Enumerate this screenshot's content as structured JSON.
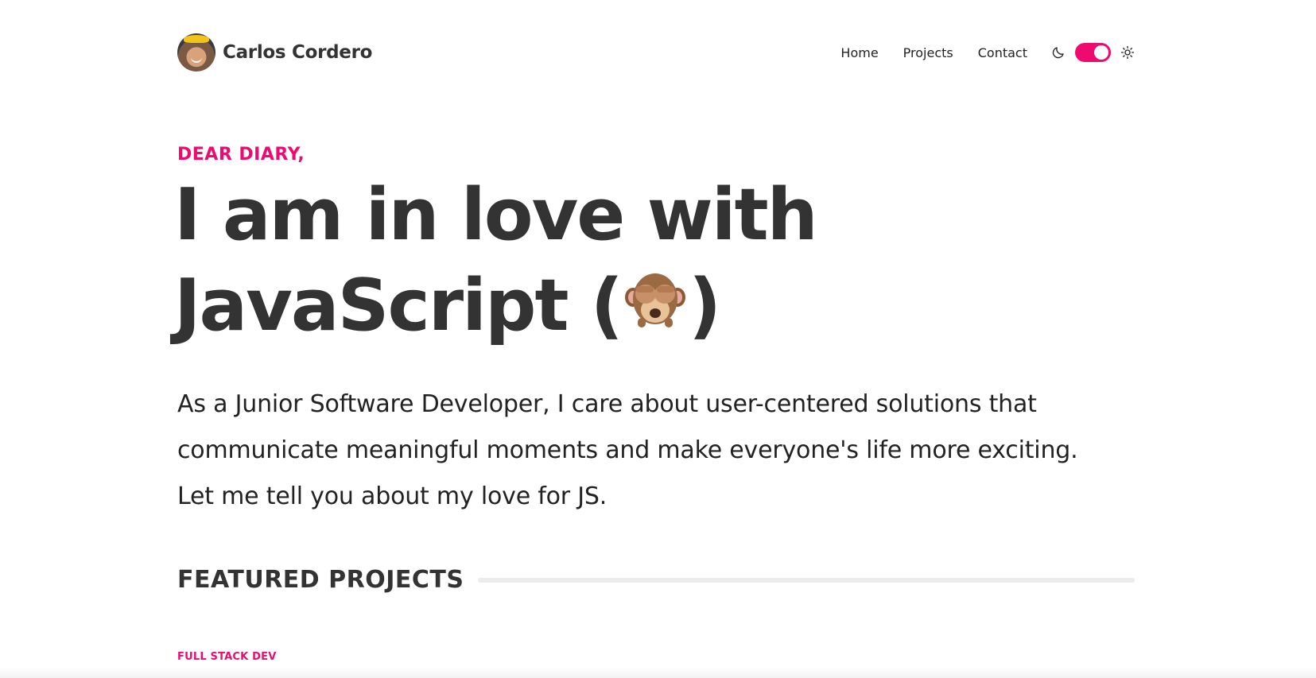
{
  "header": {
    "brand_name": "Carlos Cordero",
    "nav": [
      {
        "label": "Home"
      },
      {
        "label": "Projects"
      },
      {
        "label": "Contact"
      }
    ],
    "theme_toggle": {
      "state": "on",
      "left_icon": "moon-icon",
      "right_icon": "sun-icon"
    }
  },
  "hero": {
    "eyebrow": "DEAR DIARY,",
    "headline_line1": "I am in love with",
    "headline_line2_prefix": "JavaScript (",
    "headline_emoji": "see-no-evil-monkey-icon",
    "headline_line2_suffix": ")",
    "intro_line1": "As a Junior Software Developer, I care about user-centered solutions that",
    "intro_line2": "communicate meaningful moments and make everyone's life more exciting.",
    "intro_line3": "Let me tell you about my love for JS."
  },
  "featured": {
    "heading": "FEATURED PROJECTS",
    "first_category": "FULL STACK DEV"
  },
  "colors": {
    "accent": "#ee0a6f",
    "text": "#333333",
    "rule": "#ebebeb"
  }
}
